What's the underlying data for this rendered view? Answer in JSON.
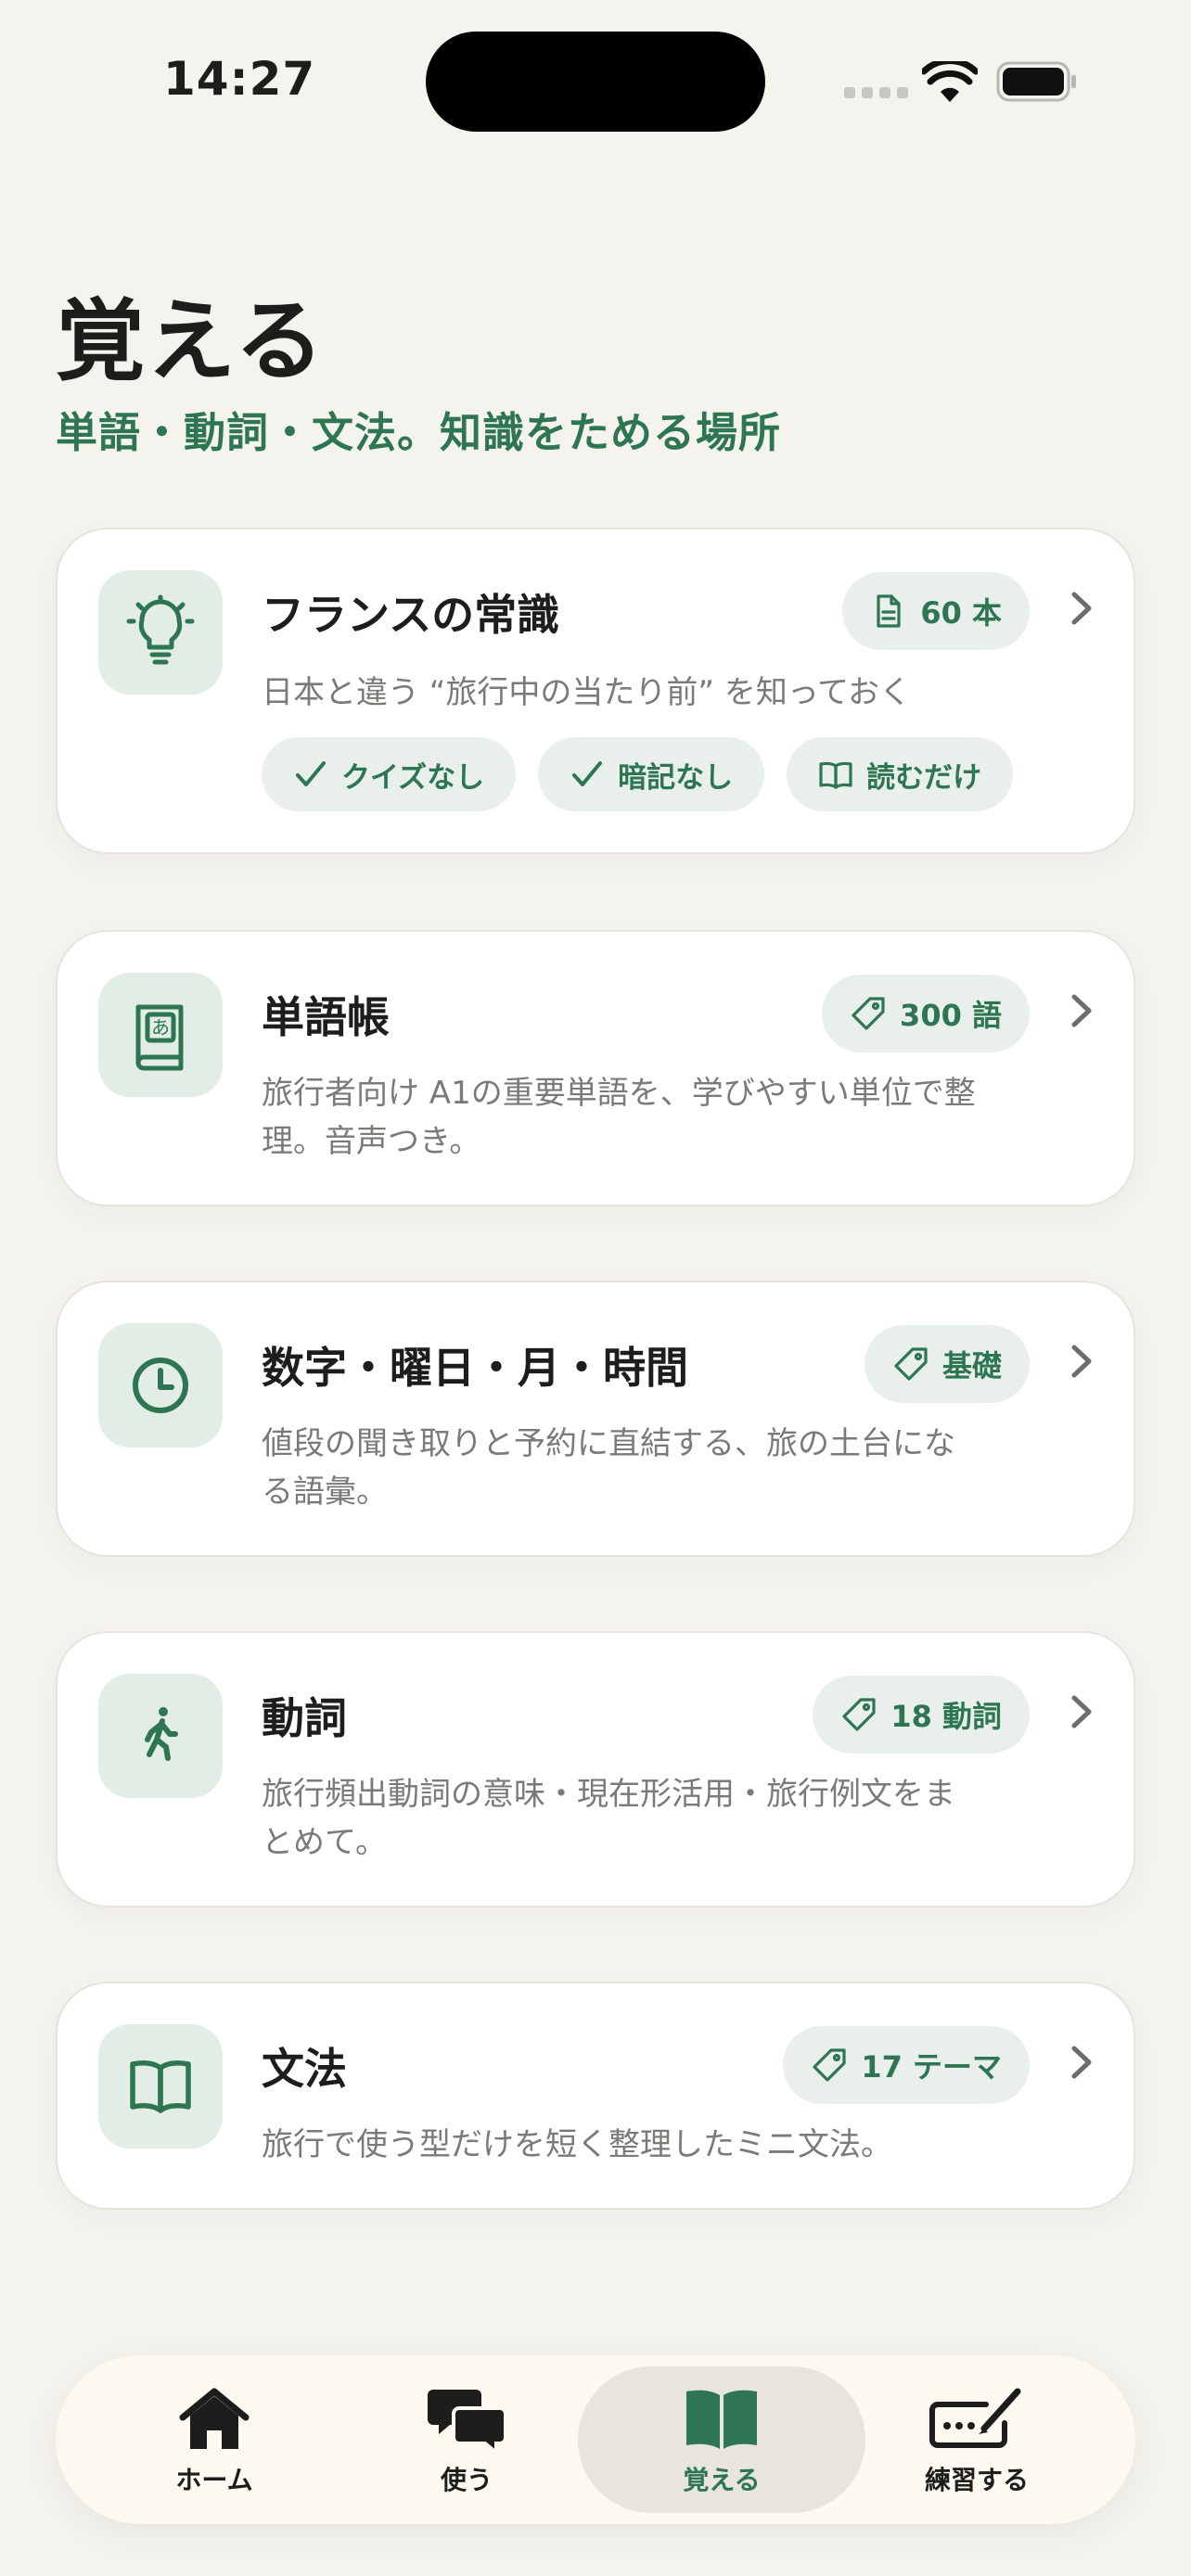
{
  "status_bar": {
    "time": "14:27"
  },
  "header": {
    "title": "覚える",
    "subtitle": "単語・動詞・文法。知識をためる場所"
  },
  "cards": [
    {
      "icon": "lightbulb-icon",
      "title": "フランスの常識",
      "badge_icon": "document-icon",
      "badge": "60 本",
      "description": "日本と違う “旅行中の当たり前” を知っておく",
      "chips": [
        {
          "icon": "check-icon",
          "label": "クイズなし"
        },
        {
          "icon": "check-icon",
          "label": "暗記なし"
        },
        {
          "icon": "open-book-icon",
          "label": "読むだけ"
        }
      ]
    },
    {
      "icon": "dictionary-icon",
      "title": "単語帳",
      "badge_icon": "tag-icon",
      "badge": "300 語",
      "description": "旅行者向け A1の重要単語を、学びやすい単位で整理。音声つき。"
    },
    {
      "icon": "clock-icon",
      "title": "数字・曜日・月・時間",
      "badge_icon": "tag-icon",
      "badge": "基礎",
      "description": "値段の聞き取りと予約に直結する、旅の土台になる語彙。"
    },
    {
      "icon": "walking-person-icon",
      "title": "動詞",
      "badge_icon": "tag-icon",
      "badge": "18 動詞",
      "description": "旅行頻出動詞の意味・現在形活用・旅行例文をまとめて。"
    },
    {
      "icon": "open-book-icon",
      "title": "文法",
      "badge_icon": "tag-icon",
      "badge": "17 テーマ",
      "description": "旅行で使う型だけを短く整理したミニ文法。"
    }
  ],
  "tab_bar": {
    "active": "覚える",
    "tabs": [
      {
        "icon": "home-icon",
        "label": "ホーム"
      },
      {
        "icon": "chat-bubbles-icon",
        "label": "使う"
      },
      {
        "icon": "book-icon",
        "label": "覚える"
      },
      {
        "icon": "pen-keyboard-icon",
        "label": "練習する"
      }
    ]
  },
  "colors": {
    "accent": "#2e7552",
    "background": "#f5f3ee",
    "card": "#ffffff",
    "icon_tile": "#e2eee5",
    "badge": "#e9efeb",
    "muted_text": "#7a7a76"
  }
}
